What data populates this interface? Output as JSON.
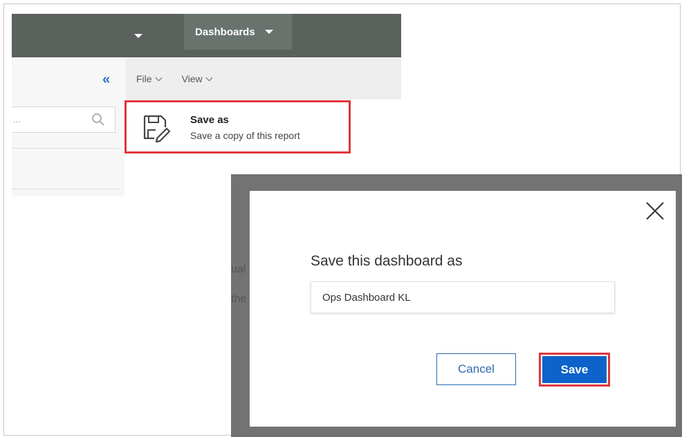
{
  "topbar": {
    "dashboards_label": "Dashboards"
  },
  "menu": {
    "file_label": "File",
    "view_label": "View"
  },
  "left_panel": {
    "search_placeholder": "..."
  },
  "save_as": {
    "title": "Save as",
    "description": "Save a copy of this report"
  },
  "background": {
    "text1": "ual",
    "text2": "the"
  },
  "dialog": {
    "title": "Save this dashboard as",
    "name_value": "Ops Dashboard KL",
    "cancel_label": "Cancel",
    "save_label": "Save"
  },
  "colors": {
    "accent": "#0d63c9",
    "highlight": "#e0363c",
    "topbar": "#5b625e"
  },
  "icons": [
    "chevron-down-icon",
    "double-chevron-left-icon",
    "search-icon",
    "save-as-icon",
    "close-icon"
  ]
}
